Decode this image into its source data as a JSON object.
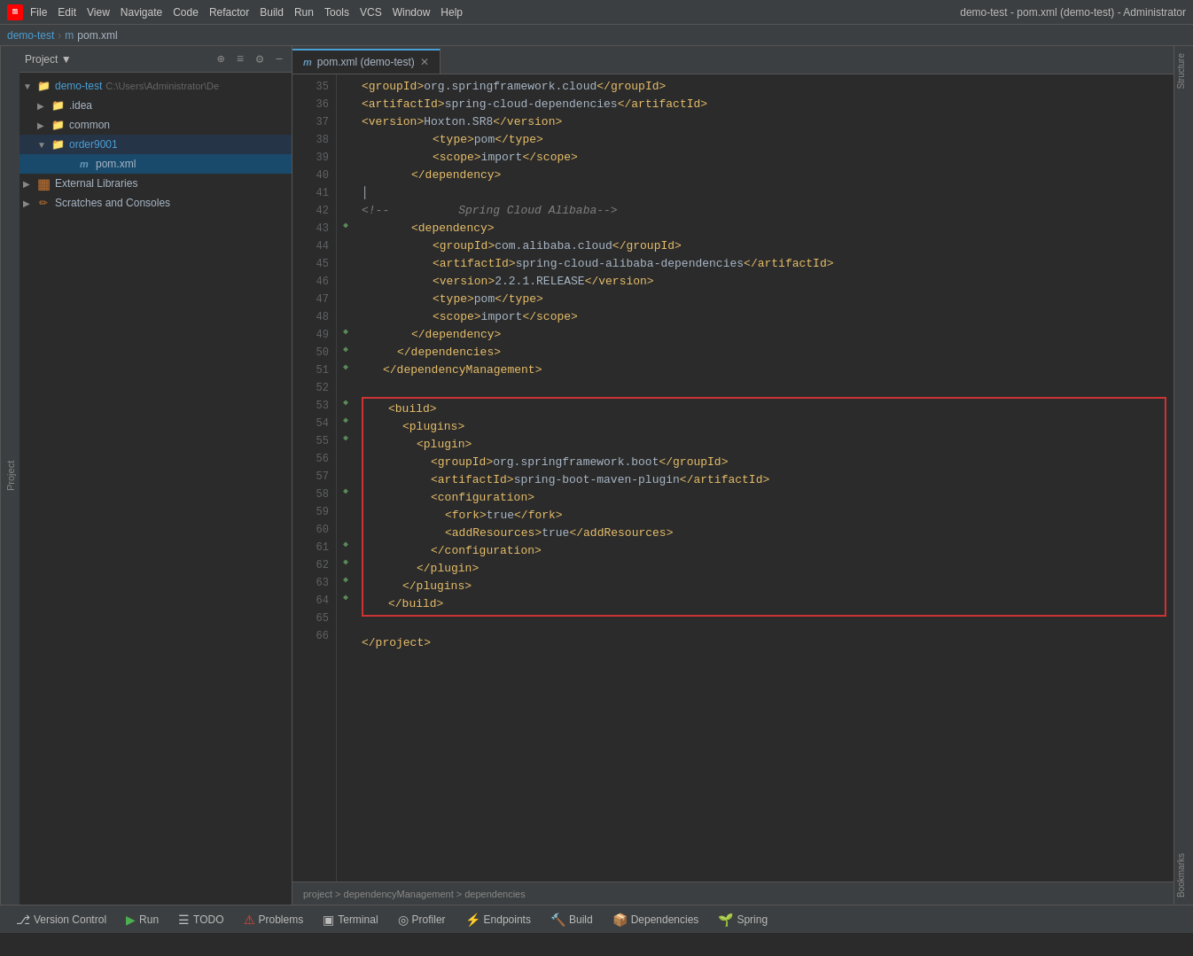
{
  "titlebar": {
    "logo": "m",
    "menu": [
      "File",
      "Edit",
      "View",
      "Navigate",
      "Code",
      "Refactor",
      "Build",
      "Run",
      "Tools",
      "VCS",
      "Window",
      "Help"
    ],
    "title": "demo-test - pom.xml (demo-test) - Administrator"
  },
  "breadcrumb": {
    "parts": [
      "demo-test",
      "pom.xml"
    ]
  },
  "project_panel": {
    "title": "Project",
    "tree": [
      {
        "label": "demo-test",
        "path": "C:\\Users\\Administrator\\De",
        "type": "root",
        "depth": 0,
        "expanded": true
      },
      {
        "label": ".idea",
        "type": "folder",
        "depth": 1,
        "expanded": false
      },
      {
        "label": "common",
        "type": "folder",
        "depth": 1,
        "expanded": false
      },
      {
        "label": "order9001",
        "type": "folder",
        "depth": 1,
        "expanded": false,
        "selected": true
      },
      {
        "label": "pom.xml",
        "type": "file",
        "depth": 2,
        "active": true
      },
      {
        "label": "External Libraries",
        "type": "libraries",
        "depth": 0,
        "expanded": false
      },
      {
        "label": "Scratches and Consoles",
        "type": "scratches",
        "depth": 0,
        "expanded": false
      }
    ]
  },
  "editor": {
    "tab_label": "pom.xml (demo-test)",
    "lines": [
      {
        "num": 35,
        "content": "        <groupId>org.springframework.cloud</groupId>",
        "type": "xml"
      },
      {
        "num": 36,
        "content": "        <artifactId>spring-cloud-dependencies</artifactId>",
        "type": "xml"
      },
      {
        "num": 37,
        "content": "        <version>Hoxton.SR8</version>",
        "type": "xml"
      },
      {
        "num": 38,
        "content": "        <type>pom</type>",
        "type": "xml"
      },
      {
        "num": 39,
        "content": "        <scope>import</scope>",
        "type": "xml"
      },
      {
        "num": 40,
        "content": "      </dependency>",
        "type": "xml"
      },
      {
        "num": 41,
        "content": "",
        "type": "empty"
      },
      {
        "num": 42,
        "content": "<!--          Spring Cloud Alibaba-->",
        "type": "comment"
      },
      {
        "num": 43,
        "content": "      <dependency>",
        "type": "xml"
      },
      {
        "num": 44,
        "content": "        <groupId>com.alibaba.cloud</groupId>",
        "type": "xml"
      },
      {
        "num": 45,
        "content": "        <artifactId>spring-cloud-alibaba-dependencies</artifactId>",
        "type": "xml"
      },
      {
        "num": 46,
        "content": "        <version>2.2.1.RELEASE</version>",
        "type": "xml"
      },
      {
        "num": 47,
        "content": "        <type>pom</type>",
        "type": "xml"
      },
      {
        "num": 48,
        "content": "        <scope>import</scope>",
        "type": "xml"
      },
      {
        "num": 49,
        "content": "      </dependency>",
        "type": "xml"
      },
      {
        "num": 50,
        "content": "    </dependencies>",
        "type": "xml"
      },
      {
        "num": 51,
        "content": "  </dependencyManagement>",
        "type": "xml"
      },
      {
        "num": 52,
        "content": "",
        "type": "empty"
      },
      {
        "num": 53,
        "content": "  <build>",
        "type": "xml",
        "highlight_start": true
      },
      {
        "num": 54,
        "content": "    <plugins>",
        "type": "xml",
        "highlight": true
      },
      {
        "num": 55,
        "content": "      <plugin>",
        "type": "xml",
        "highlight": true
      },
      {
        "num": 56,
        "content": "        <groupId>org.springframework.boot</groupId>",
        "type": "xml",
        "highlight": true
      },
      {
        "num": 57,
        "content": "        <artifactId>spring-boot-maven-plugin</artifactId>",
        "type": "xml",
        "highlight": true
      },
      {
        "num": 58,
        "content": "        <configuration>",
        "type": "xml",
        "highlight": true
      },
      {
        "num": 59,
        "content": "          <fork>true</fork>",
        "type": "xml",
        "highlight": true
      },
      {
        "num": 60,
        "content": "          <addResources>true</addResources>",
        "type": "xml",
        "highlight": true
      },
      {
        "num": 61,
        "content": "        </configuration>",
        "type": "xml",
        "highlight": true
      },
      {
        "num": 62,
        "content": "      </plugin>",
        "type": "xml",
        "highlight": true
      },
      {
        "num": 63,
        "content": "    </plugins>",
        "type": "xml",
        "highlight": true
      },
      {
        "num": 64,
        "content": "  </build>",
        "type": "xml",
        "highlight_end": true
      },
      {
        "num": 65,
        "content": "",
        "type": "empty"
      },
      {
        "num": 66,
        "content": "</project>",
        "type": "xml"
      }
    ]
  },
  "status_bar": {
    "breadcrumb": "project > dependencyManagement > dependencies"
  },
  "bottom_bar": {
    "buttons": [
      {
        "label": "Version Control",
        "icon": "⎇"
      },
      {
        "label": "Run",
        "icon": "▶"
      },
      {
        "label": "TODO",
        "icon": "☰"
      },
      {
        "label": "Problems",
        "icon": "⚠"
      },
      {
        "label": "Terminal",
        "icon": ">_"
      },
      {
        "label": "Profiler",
        "icon": "◎"
      },
      {
        "label": "Endpoints",
        "icon": "⚡"
      },
      {
        "label": "Build",
        "icon": "🔨"
      },
      {
        "label": "Dependencies",
        "icon": "📦"
      },
      {
        "label": "Spring",
        "icon": "🌱"
      }
    ]
  }
}
